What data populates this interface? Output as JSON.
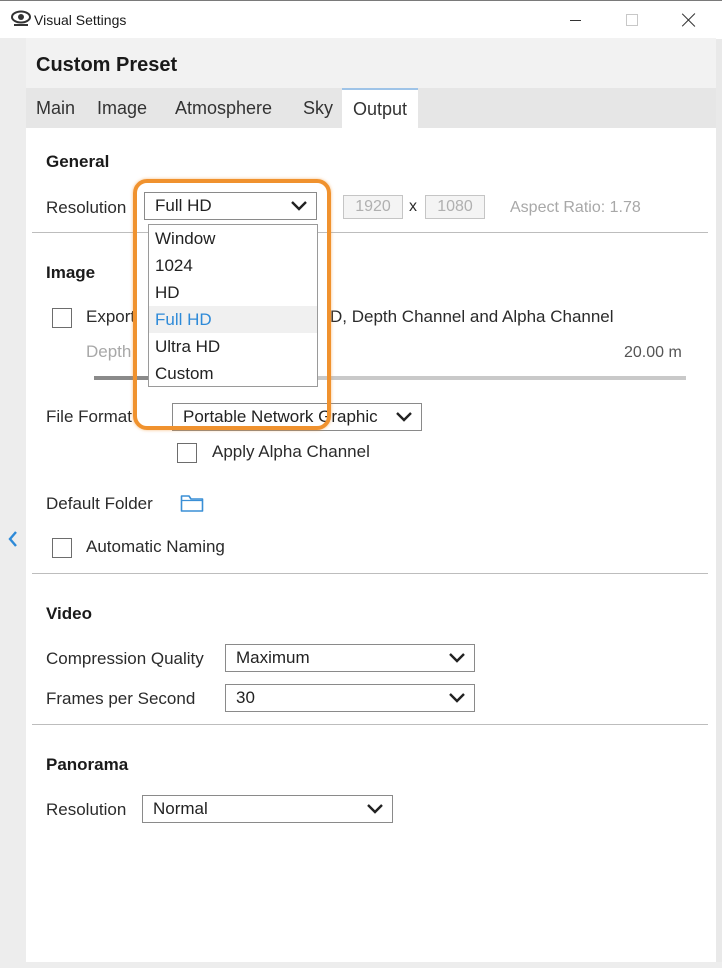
{
  "window": {
    "title": "Visual Settings",
    "icon": "eye-icon"
  },
  "preset": {
    "title": "Custom Preset"
  },
  "tabs": [
    {
      "label": "Main"
    },
    {
      "label": "Image"
    },
    {
      "label": "Atmosphere"
    },
    {
      "label": "Sky"
    },
    {
      "label": "Output",
      "active": true
    }
  ],
  "general": {
    "heading": "General",
    "resolution_label": "Resolution",
    "resolution_value": "Full HD",
    "width": "1920",
    "separator": "x",
    "height": "1080",
    "aspect_ratio": "Aspect Ratio: 1.78",
    "resolution_options": [
      "Window",
      "1024",
      "HD",
      "Full HD",
      "Ultra HD",
      "Custom"
    ],
    "selected_option": "Full HD"
  },
  "image": {
    "heading": "Image",
    "export_label_start": "Export",
    "export_label_end": "D, Depth Channel and Alpha Channel",
    "depth_label": "Depth",
    "depth_value": "20.00 m",
    "depth_slider_fraction": 0.33,
    "file_format_label": "File Format",
    "file_format_value": "Portable Network Graphic",
    "apply_alpha_label": "Apply Alpha Channel",
    "default_folder_label": "Default Folder",
    "automatic_naming_label": "Automatic Naming"
  },
  "video": {
    "heading": "Video",
    "compression_label": "Compression Quality",
    "compression_value": "Maximum",
    "fps_label": "Frames per Second",
    "fps_value": "30"
  },
  "panorama": {
    "heading": "Panorama",
    "resolution_label": "Resolution",
    "resolution_value": "Normal"
  },
  "colors": {
    "accent_highlight": "#f0922e",
    "selected_text": "#2e8ad8",
    "folder_icon": "#3a8fd6"
  }
}
